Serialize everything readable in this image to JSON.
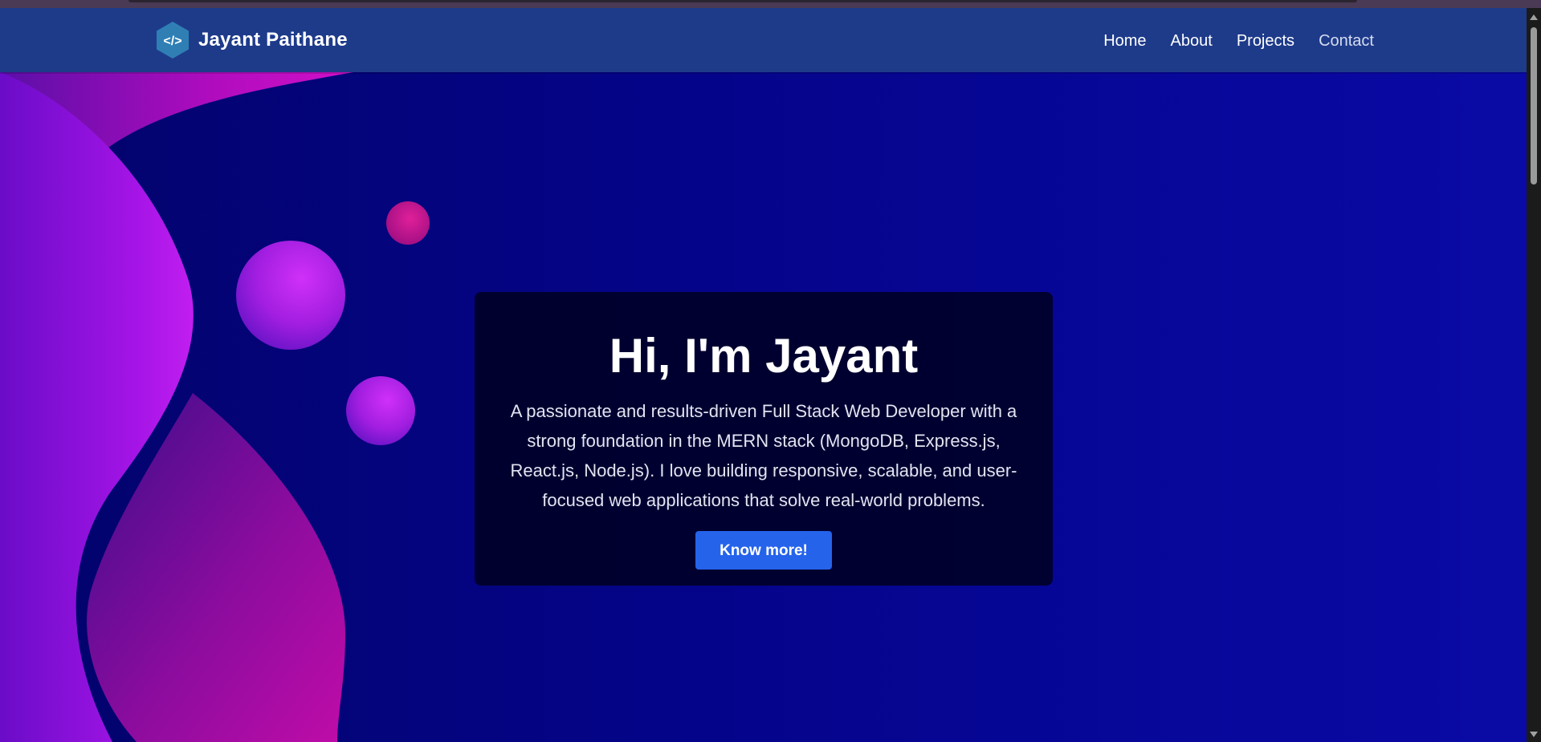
{
  "header": {
    "brand_name": "Jayant Paithane",
    "logo_icon": "code-brackets-icon",
    "logo_text": "</>"
  },
  "nav": {
    "items": [
      {
        "label": "Home"
      },
      {
        "label": "About"
      },
      {
        "label": "Projects"
      },
      {
        "label": "Contact"
      }
    ]
  },
  "hero": {
    "title": "Hi, I'm Jayant",
    "description": "A passionate and results-driven Full Stack Web Developer with a strong foundation in the MERN stack (MongoDB, Express.js, React.js, Node.js). I love building responsive, scalable, and user-focused web applications that solve real-world problems.",
    "cta_label": "Know more!"
  },
  "colors": {
    "navbar": "#1e3b8a",
    "background": "#04048a",
    "accent_button": "#2563eb",
    "magenta": "#c010d8",
    "purple": "#8a10e0"
  }
}
